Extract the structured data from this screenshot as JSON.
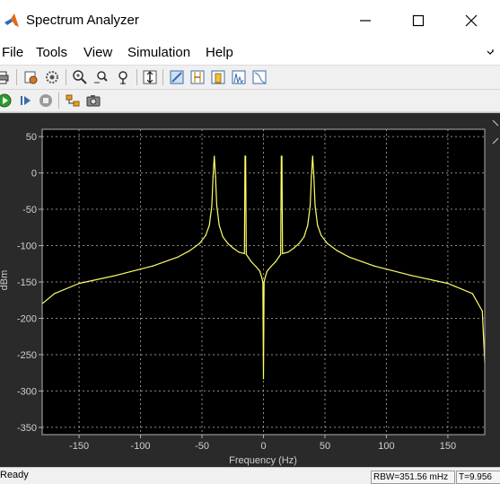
{
  "window": {
    "title": "Spectrum Analyzer"
  },
  "menu": [
    "File",
    "Tools",
    "View",
    "Simulation",
    "Help"
  ],
  "status": {
    "left": "Ready",
    "rbw": "RBW=351.56 mHz",
    "time": "T=9.956"
  },
  "colors": {
    "plot_bg": "#000000",
    "figure_bg": "#2a2a2a",
    "trace": "#ffff66",
    "grid": "#ffffff"
  },
  "toolbar_icons": [
    "print-icon",
    "restore-settings-icon",
    "settings-icon",
    "zoom-in-icon",
    "zoom-x-icon",
    "zoom-y-icon",
    "scale-axes-icon",
    "properties-icon",
    "cursor-measurements-icon",
    "channel-measurements-icon",
    "distortion-measurements-icon",
    "ccdf-icon",
    "run-icon",
    "step-forward-icon",
    "stop-icon",
    "highlight-simulink-icon",
    "snapshot-icon"
  ],
  "chart_data": {
    "type": "line",
    "title": "",
    "xlabel": "Frequency (Hz)",
    "ylabel": "dBm",
    "xlim": [
      -180,
      180
    ],
    "ylim": [
      -360,
      60
    ],
    "xticks": [
      -150,
      -100,
      -50,
      0,
      50,
      100,
      150
    ],
    "yticks": [
      50,
      0,
      -50,
      -100,
      -150,
      -200,
      -250,
      -300,
      -350
    ],
    "grid": true,
    "series": [
      {
        "x": [
          -180,
          -170,
          -150,
          -120,
          -90,
          -70,
          -60,
          -52,
          -47,
          -44,
          -42,
          -41,
          -40,
          -39,
          -38,
          -36,
          -33,
          -29,
          -25,
          -20,
          -15.5,
          -15,
          -14.5,
          -14,
          -10,
          -6,
          -3,
          -1.5,
          -0.5,
          0,
          0.5,
          1.5,
          3,
          6,
          10,
          14,
          14.5,
          15,
          15.5,
          20,
          25,
          29,
          33,
          36,
          38,
          39,
          40,
          41,
          42,
          44,
          47,
          52,
          60,
          70,
          90,
          120,
          150,
          170,
          178,
          180
        ],
        "y": [
          -180,
          -166,
          -152,
          -141,
          -128,
          -116,
          -107,
          -97,
          -86,
          -72,
          -45,
          -5,
          23,
          -5,
          -45,
          -72,
          -88,
          -97,
          -103,
          -109,
          -111,
          23,
          23,
          -112,
          -122,
          -129,
          -135,
          -143,
          -150,
          -283,
          -150,
          -143,
          -135,
          -129,
          -122,
          -112,
          23,
          23,
          -111,
          -109,
          -103,
          -97,
          -88,
          -72,
          -45,
          -5,
          23,
          -5,
          -45,
          -72,
          -86,
          -97,
          -107,
          -116,
          -128,
          -141,
          -152,
          -166,
          -190,
          -260
        ]
      }
    ]
  }
}
